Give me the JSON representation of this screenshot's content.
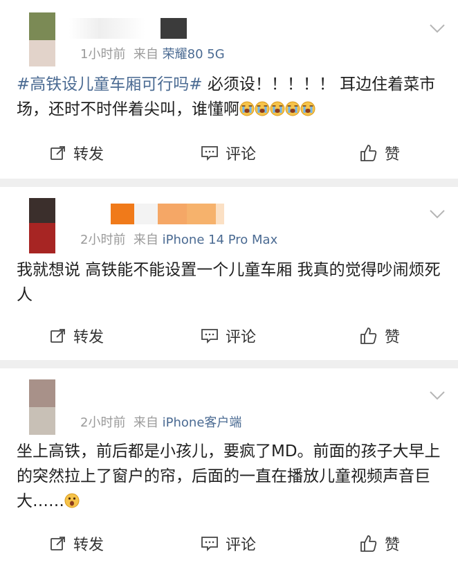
{
  "posts": [
    {
      "time": "1小时前",
      "source_prefix": "来自",
      "device": "荣耀80 5G",
      "topic": "#高铁设儿童车厢可行吗#",
      "text": " 必须设！！！！！ 耳边住着菜市场，还时不时伴着尖叫，谁懂啊",
      "emoji": [
        "crying-face",
        "crying-face",
        "crying-face",
        "crying-face",
        "crying-face"
      ]
    },
    {
      "time": "2小时前",
      "source_prefix": "来自",
      "device": "iPhone 14 Pro Max",
      "topic": "",
      "text": "我就想说 高铁能不能设置一个儿童车厢 我真的觉得吵闹烦死人",
      "emoji": []
    },
    {
      "time": "2小时前",
      "source_prefix": "来自",
      "device": "iPhone客户端",
      "topic": "",
      "text": "坐上高铁，前后都是小孩儿，要疯了MD。前面的孩子大早上的突然拉上了窗户的帘，后面的一直在播放儿童视频声音巨大……",
      "emoji": [
        "shocked-face"
      ]
    }
  ],
  "actions": {
    "repost": "转发",
    "comment": "评论",
    "like": "赞"
  },
  "colors": {
    "link": "#4a6a92",
    "meta": "#9a9a9a",
    "separator": "#efefef"
  }
}
